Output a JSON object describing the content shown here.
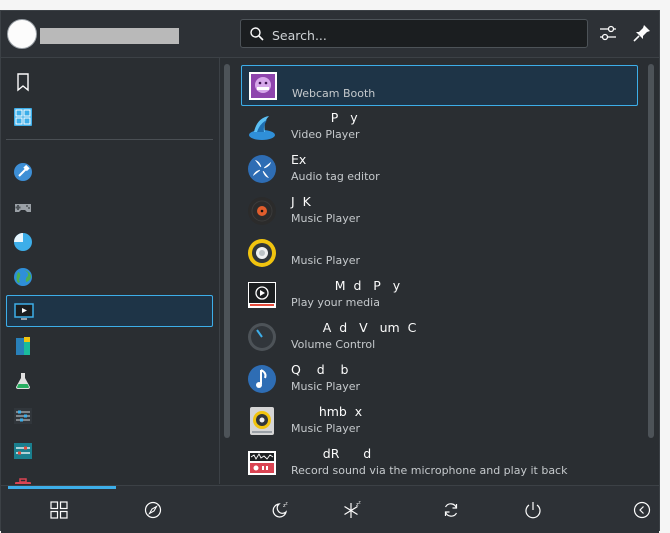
{
  "header": {
    "search_placeholder": "Search..."
  },
  "sidebar": {
    "items": [
      {
        "icon": "bookmark-icon"
      },
      {
        "icon": "all-applications-icon"
      },
      {
        "icon": "development-icon"
      },
      {
        "icon": "games-icon"
      },
      {
        "icon": "graphics-icon"
      },
      {
        "icon": "internet-icon"
      },
      {
        "icon": "multimedia-icon",
        "selected": true
      },
      {
        "icon": "office-icon"
      },
      {
        "icon": "science-icon"
      },
      {
        "icon": "settings-icon"
      },
      {
        "icon": "system-icon"
      },
      {
        "icon": "utilities-icon"
      }
    ]
  },
  "apps": [
    {
      "name": "",
      "desc": "Webcam Booth",
      "icon": "webcam-booth-icon"
    },
    {
      "name": "          P   y",
      "desc": "Video Player",
      "icon": "video-player-icon"
    },
    {
      "name": "Ex",
      "desc": "Audio tag editor",
      "icon": "audio-tag-editor-icon"
    },
    {
      "name": "J  K",
      "desc": "Music Player",
      "icon": "vinyl-player-icon"
    },
    {
      "name": "",
      "desc": "Music Player",
      "icon": "speaker-player-icon"
    },
    {
      "name": "           M  d   P   y",
      "desc": "Play your media",
      "icon": "media-player-icon"
    },
    {
      "name": "        A  d   V   um  C",
      "desc": "Volume Control",
      "icon": "volume-control-icon"
    },
    {
      "name": "Q    d    b",
      "desc": "Music Player",
      "icon": "music-note-player-icon"
    },
    {
      "name": "       hmb  x",
      "desc": "Music Player",
      "icon": "rhythmbox-player-icon"
    },
    {
      "name": "        dR      d",
      "desc": "Record sound via the microphone and play it back",
      "icon": "sound-recorder-icon"
    }
  ],
  "footer": {
    "tabs": [
      {
        "icon": "applications-grid-icon",
        "active": true
      },
      {
        "icon": "places-compass-icon",
        "active": false
      }
    ],
    "actions": [
      "sleep-icon",
      "hibernate-icon",
      "restart-icon",
      "shutdown-icon",
      "collapse-left-icon"
    ]
  },
  "colors": {
    "accent": "#3daee9",
    "panel": "#2a2e32",
    "text": "#fcfcfc"
  }
}
